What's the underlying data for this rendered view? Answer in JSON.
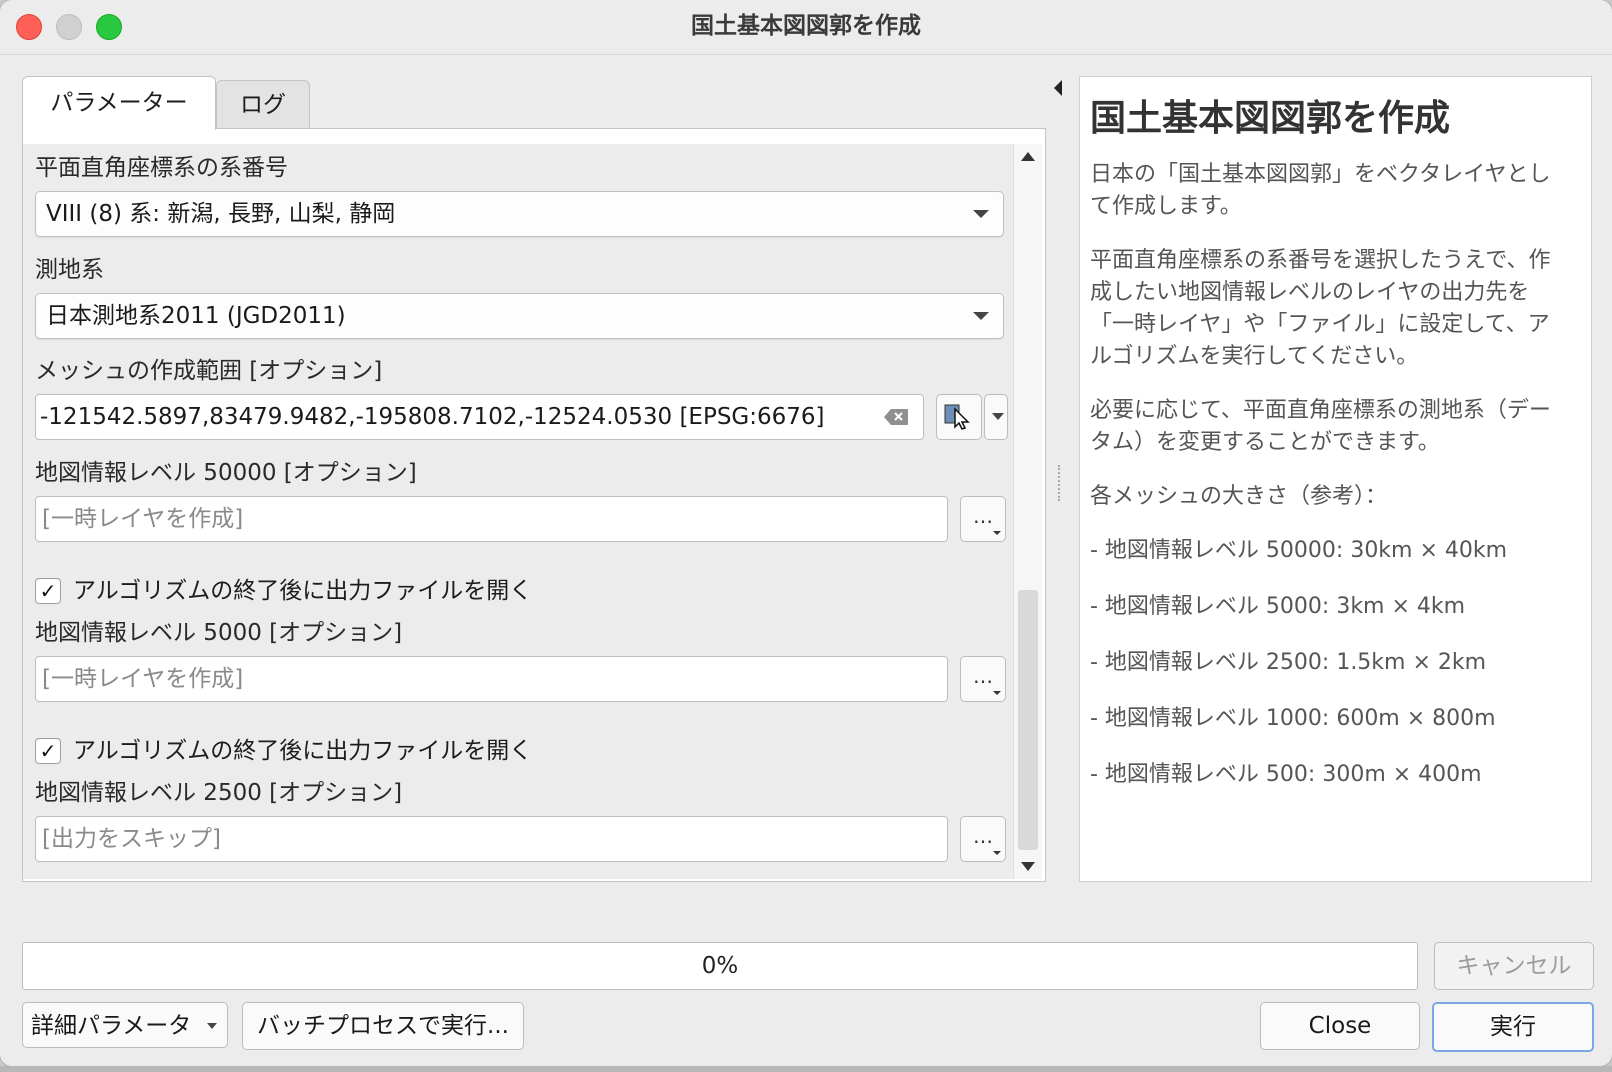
{
  "window": {
    "title": "国土基本図図郭を作成"
  },
  "tabs": [
    {
      "label": "パラメーター",
      "active": true
    },
    {
      "label": "ログ",
      "active": false
    }
  ],
  "params": {
    "crs_zone": {
      "label": "平面直角座標系の系番号",
      "value": "VIII (8) 系: 新潟, 長野, 山梨, 静岡"
    },
    "datum": {
      "label": "測地系",
      "value": "日本測地系2011 (JGD2011)"
    },
    "extent": {
      "label": "メッシュの作成範囲 [オプション]",
      "value": "-121542.5897,83479.9482,-195808.7102,-12524.0530 [EPSG:6676]"
    },
    "level50000": {
      "label": "地図情報レベル 50000 [オプション]",
      "placeholder": "[一時レイヤを作成]",
      "open_after": "アルゴリズムの終了後に出力ファイルを開く",
      "checked": true
    },
    "level5000": {
      "label": "地図情報レベル 5000 [オプション]",
      "placeholder": "[一時レイヤを作成]",
      "open_after": "アルゴリズムの終了後に出力ファイルを開く",
      "checked": true
    },
    "level2500": {
      "label": "地図情報レベル 2500 [オプション]",
      "placeholder": "[出力をスキップ]"
    },
    "browse_label": "…",
    "check_mark": "✓"
  },
  "help": {
    "title": "国土基本図図郭を作成",
    "paragraphs": [
      "日本の「国土基本図図郭」をベクタレイヤとして作成します。",
      "平面直角座標系の系番号を選択したうえで、作成したい地図情報レベルのレイヤの出力先を「一時レイヤ」や「ファイル」に設定して、アルゴリズムを実行してください。",
      "必要に応じて、平面直角座標系の測地系（データム）を変更することができます。",
      "各メッシュの大きさ（参考）：",
      "- 地図情報レベル 50000: 30km × 40km",
      "- 地図情報レベル 5000: 3km × 4km",
      "- 地図情報レベル 2500: 1.5km × 2km",
      "- 地図情報レベル 1000: 600m × 800m",
      "- 地図情報レベル 500: 300m × 400m"
    ]
  },
  "footer": {
    "progress": {
      "text": "0%",
      "value": 0
    },
    "cancel": "キャンセル",
    "advanced": "詳細パラメータ",
    "batch": "バッチプロセスで実行...",
    "close": "Close",
    "run": "実行"
  }
}
